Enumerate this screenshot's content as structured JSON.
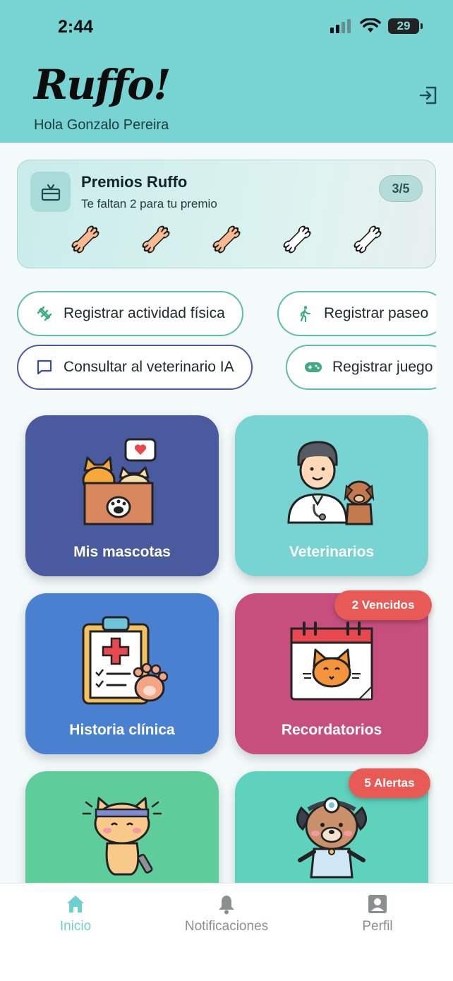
{
  "status": {
    "time": "2:44",
    "battery": "29"
  },
  "header": {
    "logo": "Ruffo!",
    "greeting": "Hola Gonzalo Pereira"
  },
  "rewards": {
    "title": "Premios Ruffo",
    "subtitle": "Te faltan 2 para tu premio",
    "count": "3/5",
    "earned": 3,
    "total": 5,
    "colors": {
      "earned": "#f6b990",
      "pending": "#ffffff"
    }
  },
  "quick_actions": [
    {
      "label": "Registrar actividad física",
      "icon": "dumbbell-icon"
    },
    {
      "label": "Registrar paseo",
      "icon": "walking-icon"
    },
    {
      "label": "Consultar al veterinario IA",
      "icon": "chat-icon"
    },
    {
      "label": "Registrar juego",
      "icon": "gamepad-icon"
    }
  ],
  "tiles": [
    {
      "label": "Mis mascotas",
      "color": "#4a5a9e"
    },
    {
      "label": "Veterinarios",
      "color": "#78d3d3"
    },
    {
      "label": "Historia clínica",
      "color": "#4a80d0"
    },
    {
      "label": "Recordatorios",
      "color": "#c64f7e",
      "badge": "2 Vencidos"
    },
    {
      "label": "",
      "color": "#5ecc9b"
    },
    {
      "label": "",
      "color": "#5fd2bd",
      "badge": "5 Alertas"
    }
  ],
  "tabbar": [
    {
      "label": "Inicio",
      "icon": "home-icon",
      "active": true
    },
    {
      "label": "Notificaciones",
      "icon": "bell-icon",
      "active": false
    },
    {
      "label": "Perfil",
      "icon": "profile-icon",
      "active": false
    }
  ]
}
